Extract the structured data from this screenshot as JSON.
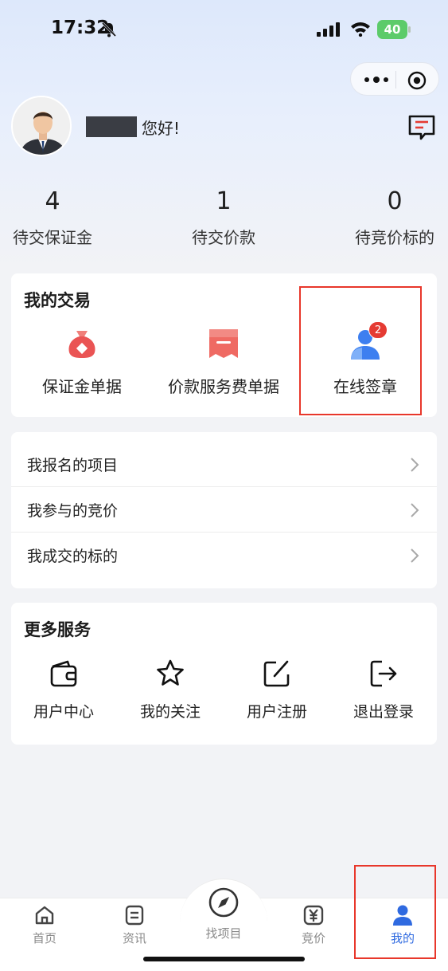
{
  "status_bar": {
    "time": "17:32",
    "battery": "40"
  },
  "profile": {
    "greeting": "您好!"
  },
  "stats": [
    {
      "value": "4",
      "label": "待交保证金"
    },
    {
      "value": "1",
      "label": "待交价款"
    },
    {
      "value": "0",
      "label": "待竞价标的"
    }
  ],
  "trade": {
    "title": "我的交易",
    "items": [
      {
        "label": "保证金单据",
        "icon": "money-bag-icon"
      },
      {
        "label": "价款服务费单据",
        "icon": "receipt-icon"
      },
      {
        "label": "在线签章",
        "icon": "user-sign-icon",
        "badge": "2"
      }
    ]
  },
  "list": [
    {
      "label": "我报名的项目"
    },
    {
      "label": "我参与的竞价"
    },
    {
      "label": "我成交的标的"
    }
  ],
  "more": {
    "title": "更多服务",
    "items": [
      {
        "label": "用户中心",
        "icon": "wallet-icon"
      },
      {
        "label": "我的关注",
        "icon": "star-icon"
      },
      {
        "label": "用户注册",
        "icon": "edit-icon"
      },
      {
        "label": "退出登录",
        "icon": "logout-icon"
      }
    ]
  },
  "tabs": [
    {
      "label": "首页",
      "icon": "home-icon"
    },
    {
      "label": "资讯",
      "icon": "news-icon"
    },
    {
      "label": "找项目",
      "icon": "compass-icon"
    },
    {
      "label": "竞价",
      "icon": "yuan-icon"
    },
    {
      "label": "我的",
      "icon": "user-icon",
      "active": true
    }
  ],
  "colors": {
    "accent": "#2f6ae0",
    "highlight": "#e8372b",
    "badge": "#e53b33"
  }
}
